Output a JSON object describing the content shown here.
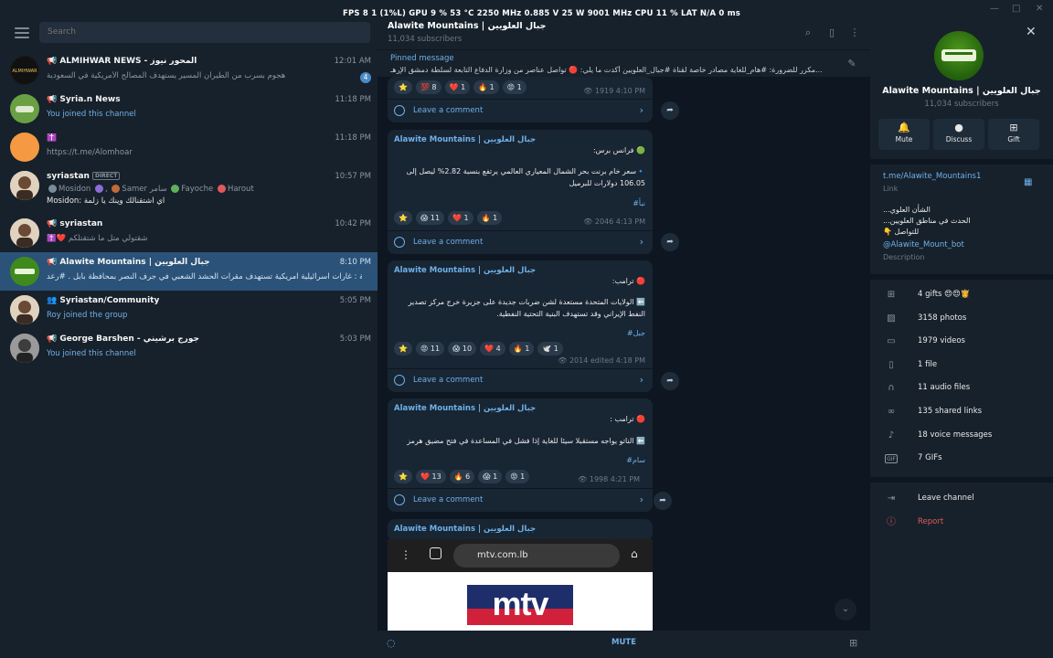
{
  "overlay": {
    "text": "FPS   8   1 (1%L)    GPU  9 %  53 °C  2250 MHz  0.885 V  25 W  9001 MHz    CPU  11 %    LAT  N/A  0 ms"
  },
  "search": {
    "placeholder": "Search"
  },
  "chats": [
    {
      "name": "📢 ALMIHWAR NEWS - المحور نيوز",
      "time": "12:01 AM",
      "preview": "هجوم بسرب من الطيران المسير يستهدف المصالح الأمريكية في السعودية",
      "badge": "4"
    },
    {
      "name": "📢 Syria.n News",
      "time": "11:18 PM",
      "preview": "You joined this channel"
    },
    {
      "name": "✝️",
      "time": "11:18 PM",
      "preview": "https://t.me/Alomhoar"
    },
    {
      "name": "syriastan",
      "tag": "DIRECT",
      "time": "10:57 PM",
      "preview_users": [
        "Mosidon",
        "Samer سامر",
        "Fayoche",
        "Harout"
      ],
      "preview": "Mosidon: اي اشتقنالك وينك يا زلمة"
    },
    {
      "name": "📢 syriastan",
      "time": "10:42 PM",
      "preview": "✝️❤️ شقتولي متل ما شتقتلكم"
    },
    {
      "name": "📢 Alawite Mountains | جبال العلويين",
      "time": "8:10 PM",
      "preview": "متابعة : غارات اسرائيلية امريكية تستهدف مقرات الحشد الشعبي في جرف النصر بمحافظة بابل . #رعد"
    },
    {
      "name": "👥 Syriastan/Community",
      "time": "5:05 PM",
      "preview": "Roy joined the group"
    },
    {
      "name": "📢 George Barshen - جورج برشيني",
      "time": "5:03 PM",
      "preview": "You joined this channel"
    }
  ],
  "header": {
    "title": "Alawite Mountains | جبال العلويين",
    "subtitle": "11,034 subscribers"
  },
  "pinned": {
    "title": "Pinned message",
    "text": "مكرر للضرورة: #هام_للغاية   مصادر خاصة لقناة #جبال_العلويين أكدت ما يلي: 🔴 تواصل عناصر من وزارة الدفاع التابعة لسلطة دمشق الإرهـ..."
  },
  "posts": [
    {
      "reactions": [
        "⭐",
        "💯 8",
        "❤️ 1",
        "🔥 1",
        "😡 1"
      ],
      "views": "1919",
      "time": "4:10 PM",
      "comment": "Leave a comment"
    },
    {
      "author": "Alawite Mountains | جبال العلويين",
      "lines": [
        "🟢 فرانس برس:",
        "🔹سعر خام برنت بحر الشمال المعياري العالمي يرتفع بنسبة 2.82% ليصل إلى",
        "106.05 دولارات للبرميل"
      ],
      "tag": "#نبأ",
      "reactions": [
        "⭐",
        "😱 11",
        "❤️ 1",
        "🔥 1"
      ],
      "views": "2046",
      "time": "4:13 PM",
      "comment": "Leave a comment"
    },
    {
      "author": "Alawite Mountains | جبال العلويين",
      "lines": [
        "🔴 ترامب:",
        "⬅️ الولايات المتحدة مستعدة لشن ضربات جديدة على جزيرة خرج مركز تصدير",
        "النفط الإيراني وقد تستهدف البنية التحتية النفطية."
      ],
      "tag": "#جبل",
      "reactions": [
        "⭐",
        "😡 11",
        "😱 10",
        "❤️ 4",
        "🔥 1",
        "🕊️ 1"
      ],
      "views": "2014",
      "time": "edited 4:18 PM",
      "comment": "Leave a comment"
    },
    {
      "author": "Alawite Mountains | جبال العلويين",
      "lines": [
        "🔴 ترامب :",
        "⬅️ الناتو يواجه مستقبلا سيئا للغاية إذا فشل  في المساعدة في فتح مضيق هرمز"
      ],
      "tag": "#سام",
      "reactions": [
        "⭐",
        "❤️ 13",
        "🔥 6",
        "😱 1",
        "😡 1"
      ],
      "views": "1998",
      "time": "4:21 PM",
      "comment": "Leave a comment"
    },
    {
      "author": "Alawite Mountains | جبال العلويين",
      "url": "mtv.com.lb",
      "logo": "mtv"
    }
  ],
  "bottom": {
    "mute": "MUTE"
  },
  "profile": {
    "name": "Alawite Mountains | جبال العلويين",
    "subscribers": "11,034 subscribers",
    "buttons": [
      "Mute",
      "Discuss",
      "Gift"
    ],
    "link": "t.me/Alawite_Mountains1",
    "link_label": "Link",
    "desc_lines": [
      "الشأن العلوي...",
      "الحدث في مناطق العلويين...",
      "للتواصل 👇"
    ],
    "handle": "@Alawite_Mount_bot",
    "handle_label": "Description",
    "media": [
      {
        "icon": "gift-icon",
        "label": "4 gifts 😍😍👸"
      },
      {
        "icon": "photo-icon",
        "label": "3158 photos"
      },
      {
        "icon": "video-icon",
        "label": "1979 videos"
      },
      {
        "icon": "file-icon",
        "label": "1 file"
      },
      {
        "icon": "headphones-icon",
        "label": "11 audio files"
      },
      {
        "icon": "link-icon",
        "label": "135 shared links"
      },
      {
        "icon": "microphone-icon",
        "label": "18 voice messages"
      },
      {
        "icon": "gif-icon",
        "label": "7 GIFs"
      }
    ],
    "leave": "Leave channel",
    "report": "Report"
  }
}
